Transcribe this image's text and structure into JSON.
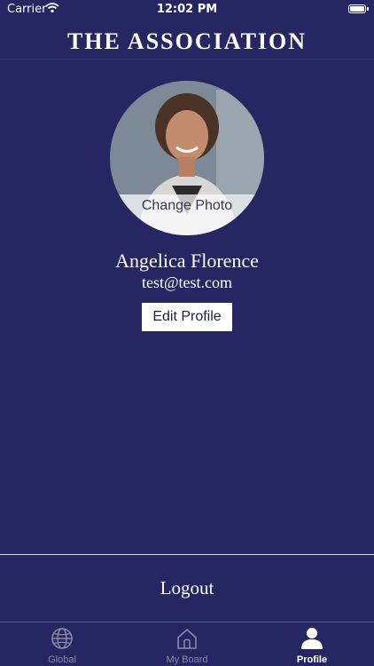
{
  "status_bar": {
    "carrier": "Carrier",
    "time": "12:02 PM"
  },
  "header": {
    "brand": "THE ASSOCIATION"
  },
  "profile": {
    "photo_action": "Change Photo",
    "name": "Angelica Florence",
    "email": "test@test.com",
    "edit_label": "Edit Profile"
  },
  "logout_label": "Logout",
  "tabs": [
    {
      "label": "Global",
      "icon": "globe-icon",
      "active": false
    },
    {
      "label": "My Board",
      "icon": "home-icon",
      "active": false
    },
    {
      "label": "Profile",
      "icon": "person-icon",
      "active": true
    }
  ],
  "colors": {
    "background": "#262663",
    "tab_inactive": "#8a8aa8",
    "tab_active": "#ffffff"
  }
}
